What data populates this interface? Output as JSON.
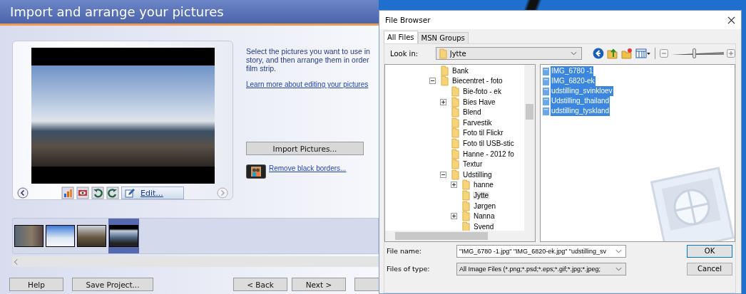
{
  "wizard": {
    "title": "Import and arrange your pictures",
    "instructions": [
      "Select the pictures you want to use in",
      "story, and then arrange them in order",
      "film strip."
    ],
    "learn_link": "Learn more about editing your pictures",
    "import_button": "Import Pictures...",
    "remove_borders_link": "Remove black borders...",
    "edit_button": "Edit...",
    "filmstrip": [
      {
        "selected": false
      },
      {
        "selected": false
      },
      {
        "selected": false
      },
      {
        "selected": true
      }
    ],
    "buttons": [
      "Help",
      "Save Project...",
      "< Back",
      "Next >"
    ]
  },
  "dialog": {
    "title": "File Browser",
    "tabs": [
      {
        "label": "All Files",
        "selected": true
      },
      {
        "label": "MSN Groups",
        "selected": false
      }
    ],
    "look_in_label": "Look in:",
    "look_in_value": "Jytte",
    "slider": {
      "level": 0.43
    },
    "tree": [
      {
        "label": "Bank",
        "selected": false
      },
      {
        "label": "Biecentret - foto",
        "expanded": true,
        "selected": false,
        "children": [
          {
            "label": "Bie-foto - ek",
            "selected": false
          },
          {
            "label": "Bies Have",
            "expanded": false,
            "selected": false
          },
          {
            "label": "Blend",
            "selected": false
          },
          {
            "label": "Farvestik",
            "selected": false
          },
          {
            "label": "Foto til Flickr",
            "selected": false
          },
          {
            "label": "Foto til USB-stic",
            "selected": false
          },
          {
            "label": "Hanne - 2012 fo",
            "selected": false
          },
          {
            "label": "Textur",
            "selected": false
          },
          {
            "label": "Udstilling",
            "expanded": true,
            "selected": false,
            "children": [
              {
                "label": "hanne",
                "expanded": false,
                "selected": false
              },
              {
                "label": "Jytte",
                "selected": true
              },
              {
                "label": "Jørgen",
                "selected": false
              },
              {
                "label": "Nanna",
                "expanded": false,
                "selected": false
              },
              {
                "label": "Svend",
                "selected": false
              }
            ]
          }
        ]
      }
    ],
    "files": [
      {
        "name": "IMG_6780 -1",
        "selected": true
      },
      {
        "name": "IMG_6820-ek",
        "selected": true
      },
      {
        "name": "udstilling_svinkloev",
        "selected": true
      },
      {
        "name": "Udstilling_thailand",
        "selected": true
      },
      {
        "name": "udstilling_tyskland",
        "selected": true
      }
    ],
    "file_name_label": "File name:",
    "file_name_value": "\"IMG_6780 -1.jpg\" \"IMG_6820-ek.jpg\" \"udstilling_sv",
    "file_type_label": "Files of type:",
    "file_type_value": "All Image Files (*.png;*.psd;*.eps;*.gif;*.jpg;*.jpeg;",
    "buttons": [
      "OK",
      "Cancel"
    ]
  }
}
